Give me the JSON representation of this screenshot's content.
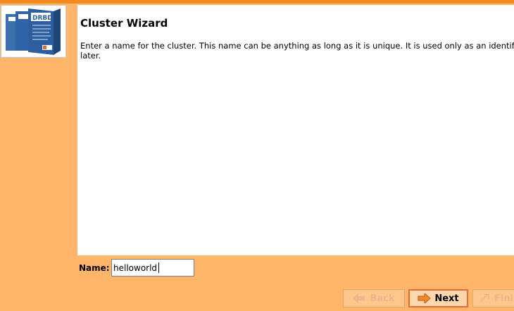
{
  "wizard": {
    "title": "Cluster Wizard",
    "description": "Enter a name for the cluster. This name can be anything as long as it is unique. It is used only as an identifier and can be changed later."
  },
  "name_field": {
    "label": "Name:",
    "value": "helloworld"
  },
  "buttons": {
    "back_label": "Back",
    "next_label": "Next",
    "finish_label": "Finish"
  },
  "icons": {
    "logo": "drbd-product-box-icon",
    "back": "arrow-left-icon",
    "next": "arrow-right-icon",
    "finish": "finish-icon"
  },
  "colors": {
    "background": "#ffb56a",
    "accent_strip": "#f28a1e",
    "panel": "#ffffff",
    "next_border": "#e36a30"
  }
}
